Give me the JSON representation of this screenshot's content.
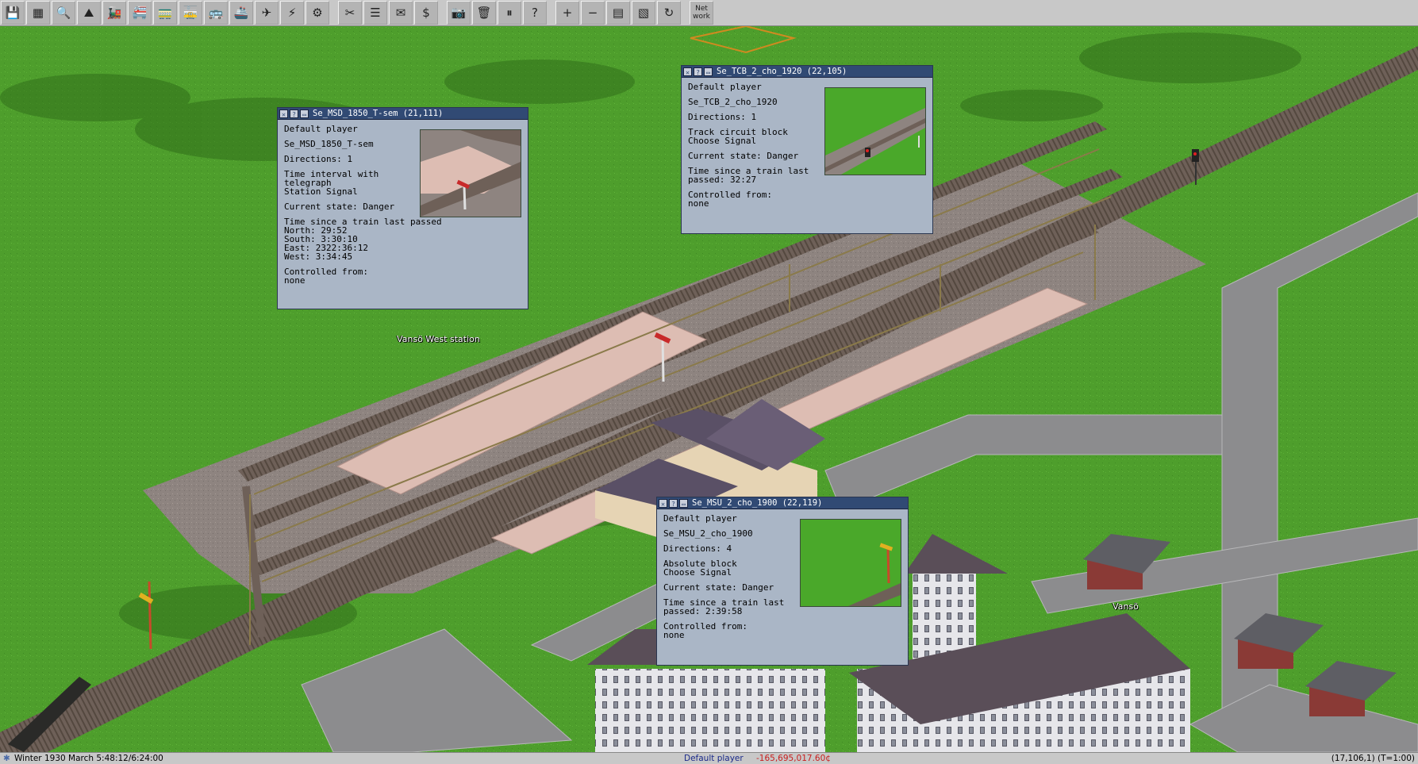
{
  "toolbar": {
    "buttons": [
      {
        "icon": "save-icon",
        "glyph": "💾"
      },
      {
        "icon": "minimap-icon",
        "glyph": "▦"
      },
      {
        "icon": "inspect-icon",
        "glyph": "🔍"
      },
      {
        "icon": "terrain-icon",
        "glyph": "⛰"
      },
      {
        "icon": "rail-tools-icon",
        "glyph": "🚂"
      },
      {
        "icon": "monorail-tools-icon",
        "glyph": "🚝"
      },
      {
        "icon": "tram-tools-icon",
        "glyph": "🚃"
      },
      {
        "icon": "tram-depot-icon",
        "glyph": "🚋"
      },
      {
        "icon": "road-tools-icon",
        "glyph": "🚌"
      },
      {
        "icon": "ship-tools-icon",
        "glyph": "🚢"
      },
      {
        "icon": "air-tools-icon",
        "glyph": "✈"
      },
      {
        "icon": "powerline-tools-icon",
        "glyph": "⚡"
      },
      {
        "icon": "special-tools-icon",
        "glyph": "⚙"
      },
      {
        "sep": true
      },
      {
        "icon": "remove-icon",
        "glyph": "✂"
      },
      {
        "icon": "list-icon",
        "glyph": "☰"
      },
      {
        "icon": "mailbox-icon",
        "glyph": "✉"
      },
      {
        "icon": "finance-icon",
        "glyph": "$"
      },
      {
        "sep": true
      },
      {
        "icon": "screenshot-icon",
        "glyph": "📷"
      },
      {
        "icon": "help-icon-bucket",
        "glyph": "🗑"
      },
      {
        "icon": "pause-icon",
        "glyph": "⏸"
      },
      {
        "icon": "question-icon",
        "glyph": "?"
      },
      {
        "sep": true
      },
      {
        "icon": "zoom-in-icon",
        "glyph": "+"
      },
      {
        "icon": "zoom-out-icon",
        "glyph": "−"
      },
      {
        "icon": "underground-icon",
        "glyph": "▤"
      },
      {
        "icon": "grid-icon",
        "glyph": "▧"
      },
      {
        "icon": "rotate-icon",
        "glyph": "↻"
      },
      {
        "sep": true
      },
      {
        "icon": "network-icon",
        "text": "Net\nwork"
      }
    ]
  },
  "map": {
    "station_label": "Vansö West station",
    "town_label": "Vansö"
  },
  "windows": [
    {
      "id": "win1",
      "title": "Se_MSD_1850_T-sem  (21,111)",
      "owner": "Default player",
      "name": "Se_MSD_1850_T-sem",
      "directions": "Directions: 1",
      "type_lines": [
        "Time interval with",
        "telegraph",
        "Station Signal"
      ],
      "state": "Current state: Danger",
      "passed_lines": [
        "Time since a train last passed",
        "North: 29:52",
        "South: 3:30:10",
        "East: 2322:36:12",
        "West: 3:34:45"
      ],
      "controlled_lines": [
        "Controlled from:",
        "none"
      ]
    },
    {
      "id": "win2",
      "title": "Se_TCB_2_cho_1920  (22,105)",
      "owner": "Default player",
      "name": "Se_TCB_2_cho_1920",
      "directions": "Directions: 1",
      "type_lines": [
        "Track circuit block",
        "Choose Signal"
      ],
      "state": "Current state: Danger",
      "passed_lines": [
        "Time since a train last",
        "passed: 32:27"
      ],
      "controlled_lines": [
        "Controlled from:",
        "none"
      ]
    },
    {
      "id": "win3",
      "title": "Se_MSU_2_cho_1900  (22,119)",
      "owner": "Default player",
      "name": "Se_MSU_2_cho_1900",
      "directions": "Directions: 4",
      "type_lines": [
        "Absolute block",
        "Choose Signal"
      ],
      "state": "Current state: Danger",
      "passed_lines": [
        "Time since a train last",
        "passed: 2:39:58"
      ],
      "controlled_lines": [
        "Controlled from:",
        "none"
      ]
    }
  ],
  "status": {
    "date": "Winter 1930 March 5:48:12/6:24:00",
    "player": "Default player",
    "money": "-165,695,017.60¢",
    "coords": "(17,106,1) (T=1:00)"
  },
  "colors": {
    "grass": "#4a9a2a",
    "window_bg": "#aab6c6",
    "titlebar": "#314a74",
    "money_negative": "#c81e1e",
    "player_text": "#1a2a8a"
  }
}
